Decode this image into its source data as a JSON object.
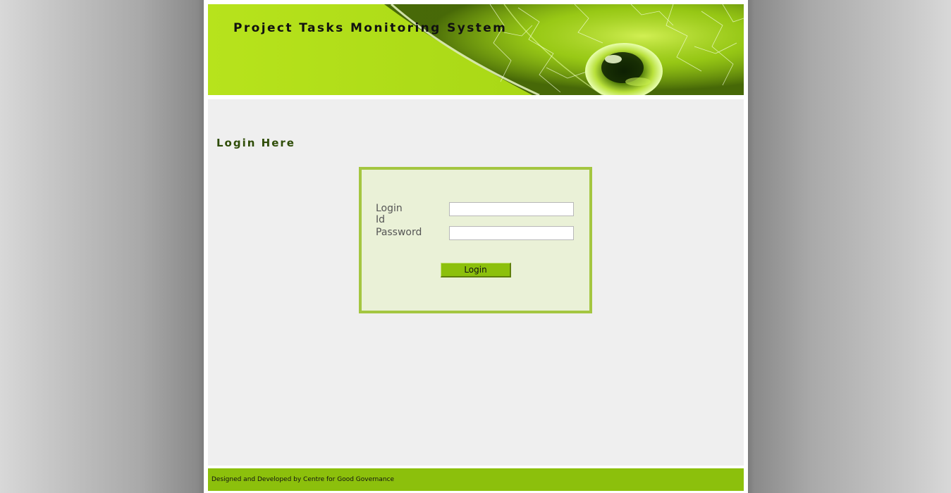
{
  "header": {
    "title": "Project Tasks Monitoring System"
  },
  "main": {
    "heading": "Login Here",
    "form": {
      "login_id_label": "Login Id",
      "login_id_value": "",
      "password_label": "Password",
      "password_value": "",
      "login_button": "Login"
    }
  },
  "footer": {
    "text": "Designed and Developed by Centre for Good Governance"
  },
  "colors": {
    "accent_green": "#8cc00c",
    "box_border": "#a4c641",
    "box_background": "#eaf1d7",
    "heading_text": "#2f4d08"
  },
  "icons": {
    "banner_image": "green-glass-droplet-banner"
  }
}
